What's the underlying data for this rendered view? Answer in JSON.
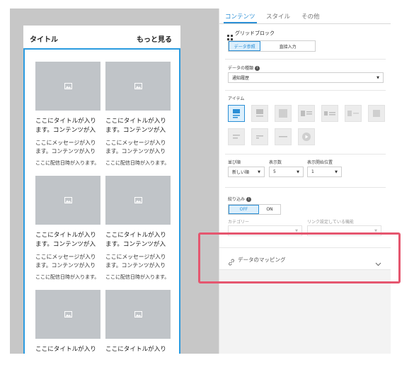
{
  "preview": {
    "header_title": "タイトル",
    "more_link": "もっと見る",
    "cards": [
      {
        "title": "ここにタイトルが入ります。コンテンツが入ります",
        "message": "ここにメッセージが入ります。コンテンツが入ります",
        "date": "ここに配信日時が入ります。"
      },
      {
        "title": "ここにタイトルが入ります。コンテンツが入ります",
        "message": "ここにメッセージが入ります。コンテンツが入ります",
        "date": "ここに配信日時が入ります。"
      },
      {
        "title": "ここにタイトルが入ります。コンテンツが入ります",
        "message": "ここにメッセージが入ります。コンテンツが入ります",
        "date": "ここに配信日時が入ります。"
      },
      {
        "title": "ここにタイトルが入ります。コンテンツが入ります",
        "message": "ここにメッセージが入ります。コンテンツが入ります",
        "date": "ここに配信日時が入ります。"
      },
      {
        "title": "ここにタイトルが入ります。コンテンツが入ります",
        "message": "",
        "date": ""
      },
      {
        "title": "ここにタイトルが入ります。コンテンツが入ります",
        "message": "",
        "date": ""
      }
    ]
  },
  "panel": {
    "tabs": [
      "コンテンツ",
      "スタイル",
      "その他"
    ],
    "active_tab": "コンテンツ",
    "block_name": "グリッドブロック",
    "mode_options": [
      "データ参照",
      "直接入力"
    ],
    "mode_selected": "データ参照",
    "data_type_label": "データの種類",
    "data_type_value": "通知履歴",
    "items_label": "アイテム",
    "sort_label": "並び順",
    "sort_value": "新しい順",
    "count_label": "表示数",
    "count_value": "5",
    "start_label": "表示開始位置",
    "start_value": "1",
    "filter_label": "絞り込み",
    "filter_options": [
      "OFF",
      "ON"
    ],
    "filter_selected": "OFF",
    "category_label": "カテゴリー",
    "link_label": "リンク設定している機能",
    "mapping_label": "データのマッピング"
  },
  "colors": {
    "accent": "#2b8fd6",
    "highlight": "#e5566f",
    "thumb": "#c0c4c8",
    "canvas": "#c7c7c7"
  }
}
